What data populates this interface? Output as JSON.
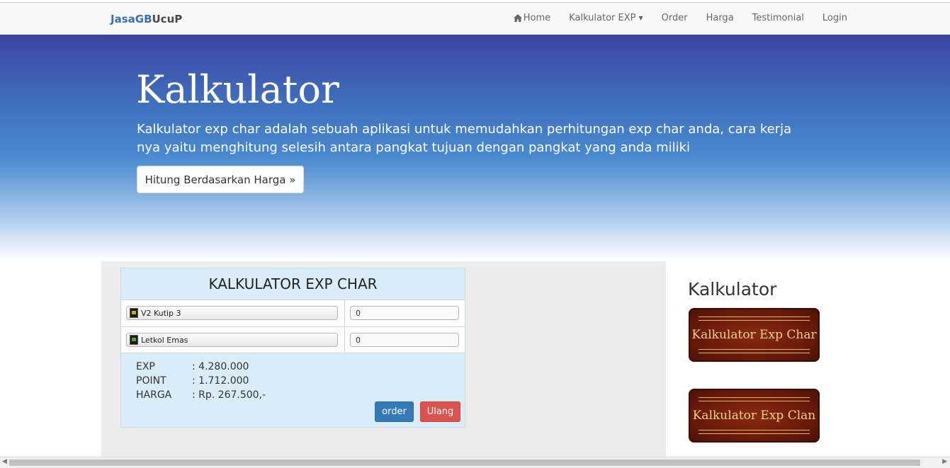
{
  "nav": {
    "brand_part1": "JasaGB",
    "brand_part2": "UcuP",
    "items": [
      {
        "label": "Home"
      },
      {
        "label": "Kalkulator EXP"
      },
      {
        "label": "Order"
      },
      {
        "label": "Harga"
      },
      {
        "label": "Testimonial"
      },
      {
        "label": "Login"
      }
    ]
  },
  "hero": {
    "title": "Kalkulator",
    "description": "Kalkulator exp char adalah sebuah aplikasi untuk memudahkan perhitungan exp char anda, cara kerja nya yaitu menghitung selesih antara pangkat tujuan dengan pangkat yang anda miliki",
    "button_label": "Hitung Berdasarkan Harga »"
  },
  "calculator": {
    "title": "KALKULATOR EXP CHAR",
    "rank_from": {
      "label": "V2 Kutip 3",
      "value": "0"
    },
    "rank_to": {
      "label": "Letkol Emas",
      "value": "0"
    },
    "results": [
      {
        "key": "EXP",
        "value": ": 4.280.000"
      },
      {
        "key": "POINT",
        "value": ": 1.712.000"
      },
      {
        "key": "HARGA",
        "value": ": Rp. 267.500,-"
      }
    ],
    "order_label": "order",
    "reset_label": "Ulang"
  },
  "sidebar": {
    "title": "Kalkulator",
    "banners": [
      {
        "label": "Kalkulator Exp Char"
      },
      {
        "label": "Kalkulator Exp Clan"
      }
    ]
  },
  "colors": {
    "primary": "#337ab7",
    "danger": "#d9534f",
    "brand": "#3a6fb0",
    "hero_top": "#3d45a3"
  }
}
